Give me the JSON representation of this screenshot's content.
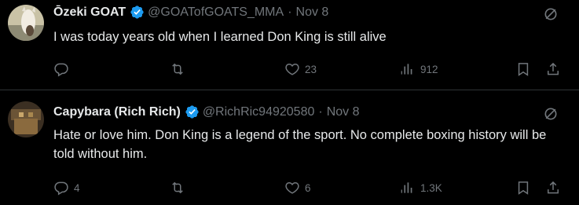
{
  "tweets": [
    {
      "name": "Ōzeki GOAT",
      "handle": "@GOATofGOATS_MMA",
      "dot": "·",
      "date": "Nov 8",
      "text": "I was today years old when I learned Don King is still alive",
      "replies": "",
      "retweets": "",
      "likes": "23",
      "views": "912"
    },
    {
      "name": "Capybara (Rich Rich)",
      "handle": "@RichRic94920580",
      "dot": "·",
      "date": "Nov 8",
      "text": "Hate or love him. Don King is a legend of the sport. No complete boxing history will be told without him.",
      "replies": "4",
      "retweets": "",
      "likes": "6",
      "views": "1.3K"
    }
  ],
  "colors": {
    "background": "#000000",
    "text": "#e7e9ea",
    "muted": "#71767b",
    "verified": "#1d9bf0",
    "divider": "#2f3336"
  },
  "icons": [
    "verified-badge-icon",
    "grok-icon",
    "reply-icon",
    "retweet-icon",
    "like-icon",
    "views-icon",
    "bookmark-icon",
    "share-icon"
  ]
}
